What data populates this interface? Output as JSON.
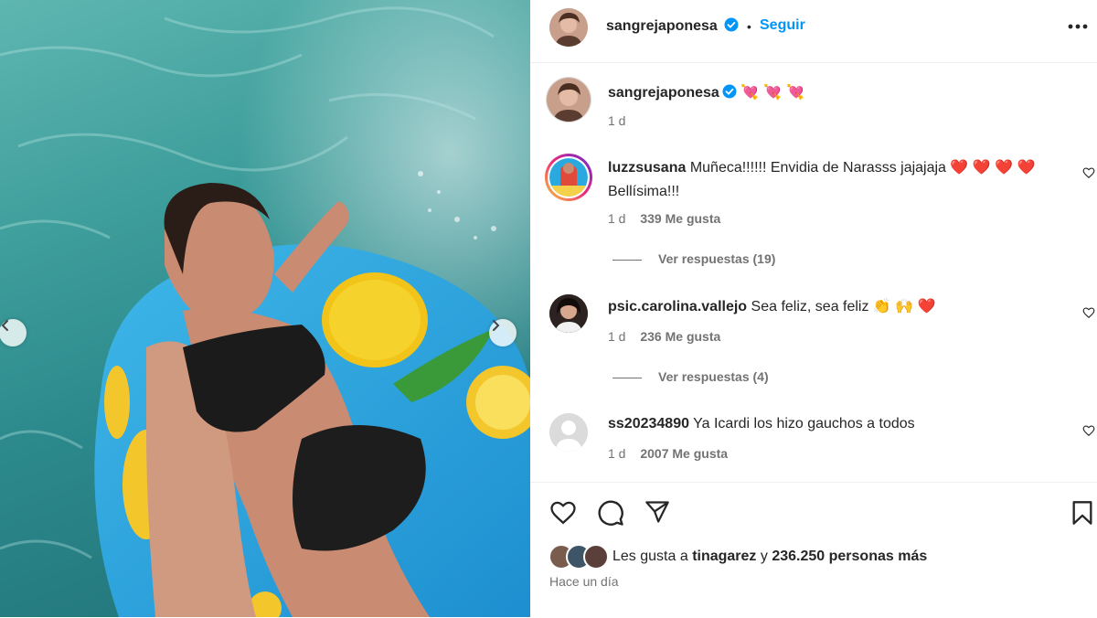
{
  "post": {
    "username": "sangrejaponesa",
    "follow_label": "Seguir",
    "separator": "•",
    "caption_emoji": "💘 💘 💘",
    "caption_time": "1 d"
  },
  "comments": [
    {
      "username": "luzzsusana",
      "text": "Muñeca!!!!!! Envidia de Narasss jajajaja ❤️ ❤️ ❤️ ❤️",
      "text2": "Bellísima!!!",
      "time": "1 d",
      "likes": "339 Me gusta",
      "replies": "Ver respuestas (19)"
    },
    {
      "username": "psic.carolina.vallejo",
      "text": "Sea feliz, sea feliz 👏 🙌 ❤️",
      "time": "1 d",
      "likes": "236 Me gusta",
      "replies": "Ver respuestas (4)"
    },
    {
      "username": "ss20234890",
      "text": "Ya Icardi los hizo gauchos a todos",
      "time": "1 d",
      "likes": "2007 Me gusta"
    }
  ],
  "footer": {
    "likes_prefix": "Les gusta a",
    "liked_by": "tinagarez",
    "likes_mid": "y",
    "likes_count": "236.250 personas más",
    "posted_ago": "Hace un día"
  },
  "colors": {
    "accent": "#0095f6",
    "verified": "#0095f6",
    "text": "#262626",
    "muted": "#737373",
    "border": "#efefef"
  },
  "icons": [
    "chevron-left-icon",
    "chevron-right-icon",
    "verified-badge-icon",
    "more-options-icon",
    "heart-icon",
    "comment-icon",
    "share-icon",
    "bookmark-icon"
  ]
}
